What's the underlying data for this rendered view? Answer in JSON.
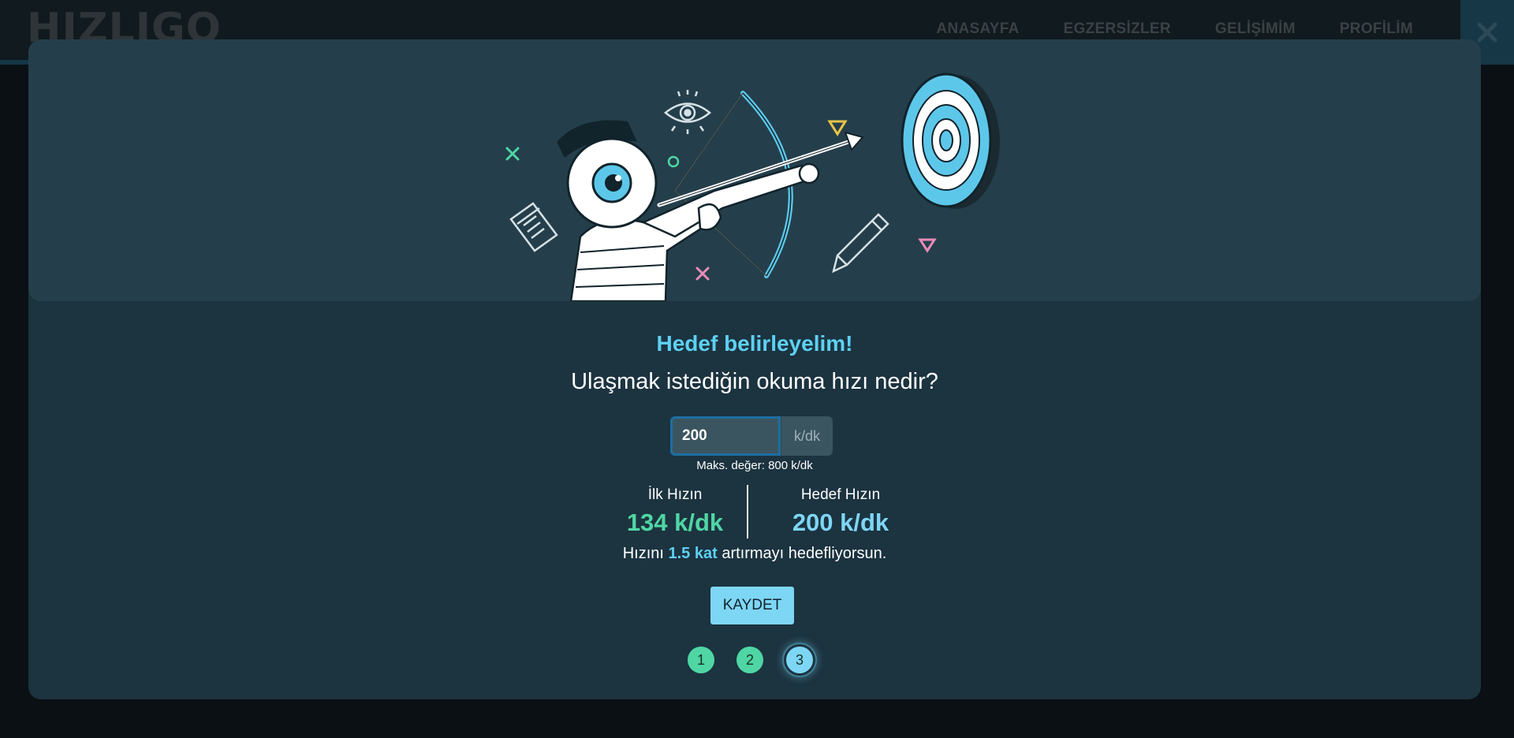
{
  "header": {
    "logo_text": "HIZLIGO",
    "nav": [
      "ANASAYFA",
      "EGZERSİZLER",
      "GELİŞİMİM",
      "PROFİLİM"
    ],
    "close_icon": "close-icon"
  },
  "modal": {
    "heading": "Hedef belirleyelim!",
    "question": "Ulaşmak istediğin okuma hızı nedir?",
    "input": {
      "value": "200",
      "unit": "k/dk"
    },
    "max_note": "Maks. değer: 800 k/dk",
    "stats": {
      "initial": {
        "label": "İlk Hızın",
        "value": "134 k/dk"
      },
      "target": {
        "label": "Hedef Hızın",
        "value": "200 k/dk"
      }
    },
    "summary": {
      "prefix": "Hızını ",
      "factor": "1.5 kat",
      "suffix": " artırmayı hedefliyorsun."
    },
    "save_label": "KAYDET",
    "steps": [
      "1",
      "2",
      "3"
    ],
    "current_step": 3
  },
  "colors": {
    "modal_bg": "#1c3340",
    "hero_bg": "#243f4b",
    "accent_blue": "#7ed6f5",
    "accent_green": "#4fd6a4"
  }
}
